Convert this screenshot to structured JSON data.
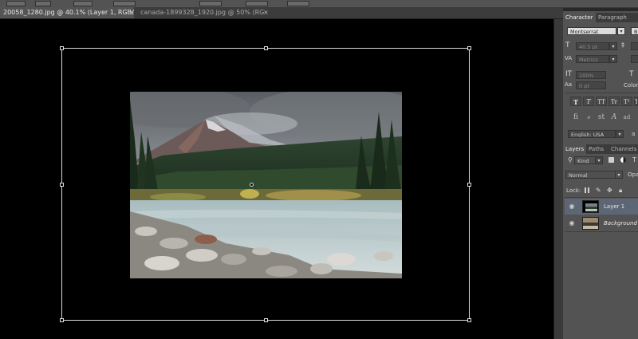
{
  "document_tabs": [
    {
      "label": "20058_1280.jpg @ 40.1% (Layer 1, RGB/8#) *",
      "active": true
    },
    {
      "label": "canada-1899328_1920.jpg @ 50% (RGB/8#)",
      "active": false
    }
  ],
  "tab_close_glyph": "×",
  "character_panel": {
    "tabs": [
      "Character",
      "Paragraph"
    ],
    "font_family": "Montserrat",
    "font_style_partial": "B",
    "font_size": "40.5 pt",
    "kerning": "Metrics",
    "vertical_scale": "100%",
    "baseline_shift": "0 pt",
    "color_label": "Color:",
    "type_buttons": [
      "T",
      "T",
      "TT",
      "Tr",
      "T¹",
      "T,"
    ],
    "opentype_buttons": [
      "fi",
      "ℴ",
      "st",
      "A",
      "ad"
    ],
    "language": "English: USA",
    "antialias_partial": "a"
  },
  "layers_panel": {
    "tabs": [
      "Layers",
      "Paths",
      "Channels"
    ],
    "filter_kind": "Kind",
    "blend_mode": "Normal",
    "opacity_partial": "Opa",
    "lock_label": "Lock:",
    "layers": [
      {
        "name": "Layer 1",
        "selected": true,
        "italic": false
      },
      {
        "name": "Background",
        "selected": false,
        "italic": true
      }
    ]
  },
  "colors": {
    "canvas_bg": "#000000",
    "panel_bg": "#535353",
    "selected_layer": "#5d6675"
  },
  "icons": [
    "close-icon",
    "eye-icon",
    "lock-pixels-icon",
    "lock-brush-icon",
    "lock-move-icon",
    "lock-all-icon",
    "search-icon",
    "dropdown-icon"
  ]
}
